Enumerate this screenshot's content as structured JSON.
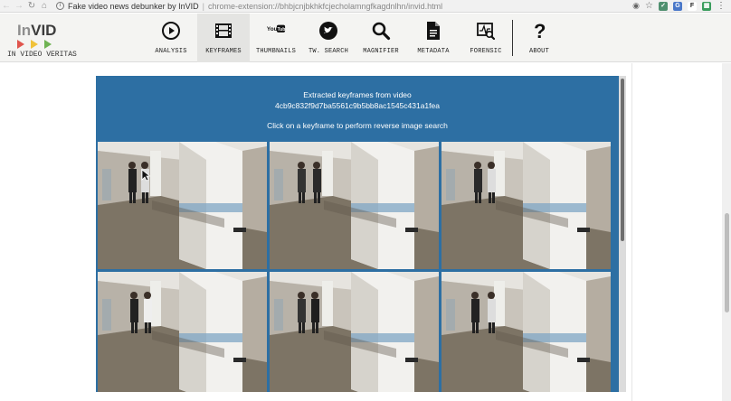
{
  "browser": {
    "tab_title": "Fake video news debunker by InVID",
    "separator": "|",
    "url": "chrome-extension://bhbjcnjbkhkfcjecholamngfkagdnlhn/invid.html"
  },
  "logo": {
    "part1": "In",
    "part2": "VID",
    "tagline": "IN VIDEO VERITAS",
    "colors": [
      "#e0554d",
      "#f0c23a",
      "#6fb353"
    ]
  },
  "nav": {
    "items": [
      {
        "label": "ANALYSIS",
        "icon": "play-circle-icon",
        "active": false
      },
      {
        "label": "KEYFRAMES",
        "icon": "film-icon",
        "active": true
      },
      {
        "label": "THUMBNAILS",
        "icon": "youtube-icon",
        "active": false
      },
      {
        "label": "TW. SEARCH",
        "icon": "twitter-icon",
        "active": false
      },
      {
        "label": "MAGNIFIER",
        "icon": "magnifier-icon",
        "active": false
      },
      {
        "label": "METADATA",
        "icon": "document-icon",
        "active": false
      },
      {
        "label": "FORENSIC",
        "icon": "forensic-icon",
        "active": false
      },
      {
        "label": "ABOUT",
        "icon": "question-icon",
        "active": false
      }
    ]
  },
  "panel": {
    "heading_line1": "Extracted keyframes from video",
    "heading_line2": "4cb9c832f9d7ba5561c9b5bb8ac1545c431a1fea",
    "instruction": "Click on a keyframe to perform reverse image search",
    "background": "#2d6fa3"
  },
  "keyframes": [
    {
      "id": 1
    },
    {
      "id": 2
    },
    {
      "id": 3
    },
    {
      "id": 4
    },
    {
      "id": 5
    },
    {
      "id": 6
    }
  ]
}
